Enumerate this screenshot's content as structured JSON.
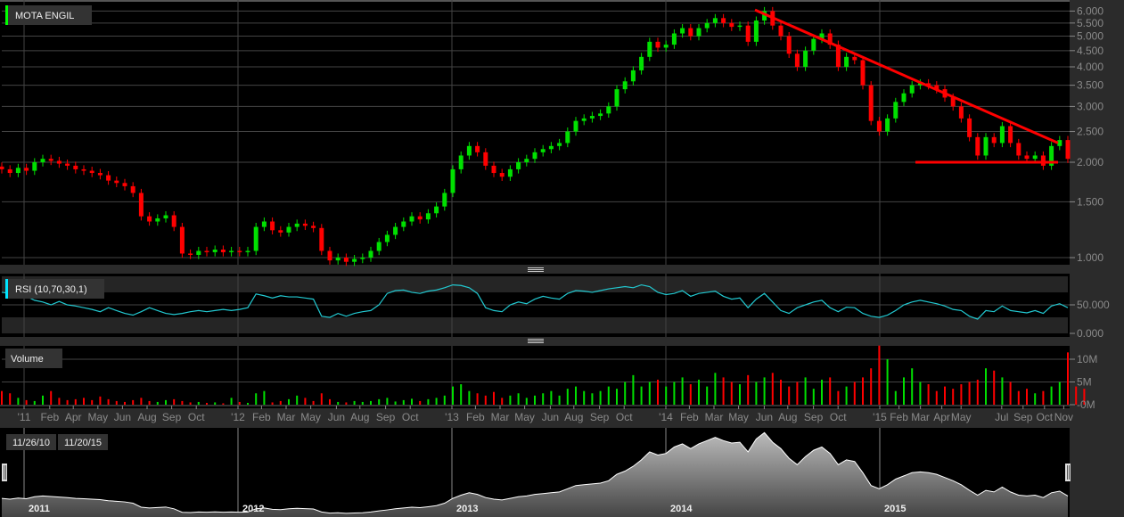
{
  "panels": {
    "price_title": "MOTA ENGIL",
    "rsi_title": "RSI (10,70,30,1)",
    "volume_title": "Volume"
  },
  "navigator": {
    "start_label": "11/26/10",
    "end_label": "11/20/15",
    "year_labels": [
      "2011",
      "2012",
      "2013",
      "2014",
      "2015"
    ]
  },
  "colors": {
    "up": "#00e000",
    "down": "#ff0000",
    "rsi": "#22c8d0",
    "trendline": "#ff0000",
    "title_marker_price": "#00ff00",
    "title_marker_rsi": "#00e5ff"
  },
  "chart_data": [
    {
      "type": "candlestick",
      "title": "MOTA ENGIL",
      "scale": "log",
      "yticks": [
        "1.000",
        "1.500",
        "2.000",
        "2.500",
        "3.000",
        "3.500",
        "4.000",
        "4.500",
        "5.000",
        "5.500",
        "6.000"
      ],
      "ytick_values": [
        1.0,
        1.5,
        2.0,
        2.5,
        3.0,
        3.5,
        4.0,
        4.5,
        5.0,
        5.5,
        6.0
      ],
      "date_range": [
        "11/26/10",
        "11/20/15"
      ],
      "close": [
        1.9,
        1.85,
        1.92,
        1.88,
        2.0,
        2.05,
        2.02,
        1.98,
        1.95,
        1.9,
        1.88,
        1.85,
        1.82,
        1.75,
        1.72,
        1.68,
        1.6,
        1.35,
        1.3,
        1.33,
        1.36,
        1.25,
        1.03,
        1.02,
        1.05,
        1.04,
        1.06,
        1.04,
        1.05,
        1.04,
        1.05,
        1.25,
        1.3,
        1.22,
        1.2,
        1.25,
        1.28,
        1.26,
        1.24,
        1.05,
        0.98,
        1.0,
        0.97,
        0.99,
        1.0,
        1.05,
        1.12,
        1.18,
        1.25,
        1.3,
        1.35,
        1.32,
        1.38,
        1.45,
        1.6,
        1.9,
        2.1,
        2.25,
        2.15,
        1.95,
        1.85,
        1.8,
        1.9,
        2.0,
        2.05,
        2.15,
        2.2,
        2.25,
        2.3,
        2.5,
        2.7,
        2.75,
        2.8,
        2.85,
        3.0,
        3.4,
        3.6,
        3.9,
        4.3,
        4.8,
        4.6,
        4.7,
        5.1,
        5.3,
        5.0,
        5.3,
        5.5,
        5.7,
        5.5,
        5.35,
        5.4,
        4.8,
        5.6,
        6.0,
        5.4,
        5.0,
        4.4,
        4.0,
        4.5,
        4.9,
        5.1,
        4.7,
        4.0,
        4.3,
        4.2,
        3.5,
        2.7,
        2.5,
        2.75,
        3.1,
        3.3,
        3.5,
        3.55,
        3.5,
        3.4,
        3.2,
        3.0,
        2.75,
        2.4,
        2.1,
        2.4,
        2.3,
        2.6,
        2.3,
        2.1,
        2.05,
        2.1,
        1.95,
        2.25,
        2.35,
        2.05
      ],
      "trendlines": [
        {
          "from": [
            "06/2014",
            6.05
          ],
          "to": [
            "11/2015",
            2.3
          ]
        },
        {
          "from": [
            "03/2015",
            2.0
          ],
          "to": [
            "11/2015",
            2.0
          ]
        }
      ]
    },
    {
      "type": "line",
      "title": "RSI (10,70,30,1)",
      "yticks": [
        "50.000",
        "0.000"
      ],
      "ytick_values": [
        50,
        0
      ],
      "bands": [
        70,
        30
      ],
      "values": [
        72,
        70,
        72,
        65,
        58,
        55,
        50,
        56,
        50,
        48,
        45,
        42,
        38,
        45,
        40,
        35,
        32,
        38,
        45,
        40,
        35,
        33,
        35,
        38,
        40,
        38,
        40,
        42,
        40,
        42,
        45,
        69,
        66,
        62,
        66,
        64,
        64,
        62,
        60,
        30,
        28,
        35,
        30,
        35,
        38,
        40,
        50,
        70,
        75,
        76,
        72,
        70,
        74,
        76,
        80,
        85,
        84,
        80,
        70,
        45,
        40,
        38,
        50,
        55,
        52,
        60,
        65,
        62,
        60,
        70,
        75,
        74,
        72,
        75,
        78,
        80,
        82,
        80,
        85,
        82,
        72,
        68,
        70,
        75,
        65,
        70,
        72,
        74,
        65,
        60,
        62,
        45,
        60,
        70,
        55,
        40,
        35,
        45,
        50,
        55,
        58,
        45,
        38,
        46,
        45,
        35,
        30,
        28,
        32,
        40,
        50,
        55,
        58,
        55,
        52,
        48,
        42,
        40,
        30,
        25,
        40,
        38,
        48,
        40,
        38,
        36,
        40,
        35,
        48,
        52,
        45
      ]
    },
    {
      "type": "bar",
      "title": "Volume",
      "yticks": [
        "10M",
        "5M",
        "-0M"
      ],
      "ytick_values": [
        10,
        5,
        0
      ],
      "unit": "M",
      "values": [
        3,
        2.5,
        1.5,
        1,
        0.8,
        2,
        3,
        1.5,
        1,
        1.2,
        1.5,
        1,
        1.8,
        1.2,
        0.8,
        0.6,
        1,
        1.5,
        0.8,
        0.6,
        1,
        1.2,
        0.8,
        0.5,
        0.6,
        0.4,
        0.5,
        0.3,
        1.5,
        0.6,
        0.4,
        2.5,
        3,
        0.5,
        0.8,
        1.2,
        2,
        1.5,
        0.8,
        2.5,
        1.2,
        0.6,
        0.5,
        0.8,
        0.6,
        0.8,
        1.2,
        1.5,
        0.7,
        1,
        1.3,
        0.8,
        1.2,
        1.5,
        2,
        4,
        4.5,
        3,
        2.5,
        2,
        2.8,
        1.5,
        2,
        2.5,
        1.5,
        2,
        2.5,
        3,
        2,
        3.5,
        4,
        3,
        2.5,
        3,
        4,
        3.5,
        5,
        6.5,
        4,
        5,
        5.5,
        4,
        5,
        6,
        4.5,
        5.5,
        4,
        7,
        6,
        5,
        4.5,
        6.5,
        5,
        6,
        7,
        5.5,
        4,
        5,
        6,
        3.5,
        5.5,
        6,
        3,
        4,
        5,
        6,
        8,
        13,
        10,
        3,
        6,
        8,
        5,
        4.5,
        3,
        4,
        3.5,
        4.5,
        5,
        5.5,
        8,
        7.5,
        6,
        5,
        3,
        3.5,
        2.5,
        3,
        4,
        5,
        11.5,
        4,
        3.5
      ]
    }
  ],
  "xaxis": {
    "ticks": [
      [
        "'11",
        2011.0
      ],
      [
        "Feb",
        2011.12
      ],
      [
        "Apr",
        2011.23
      ],
      [
        "May",
        2011.345
      ],
      [
        "Jun",
        2011.46
      ],
      [
        "Aug",
        2011.575
      ],
      [
        "Sep",
        2011.69
      ],
      [
        "Oct",
        2011.805
      ],
      [
        "'12",
        2012.0
      ],
      [
        "Feb",
        2012.11
      ],
      [
        "Mar",
        2012.225
      ],
      [
        "May",
        2012.34
      ],
      [
        "Jun",
        2012.46
      ],
      [
        "Aug",
        2012.57
      ],
      [
        "Sep",
        2012.69
      ],
      [
        "Oct",
        2012.805
      ],
      [
        "'13",
        2013.0
      ],
      [
        "Feb",
        2013.11
      ],
      [
        "Mar",
        2013.225
      ],
      [
        "May",
        2013.34
      ],
      [
        "Jun",
        2013.46
      ],
      [
        "Aug",
        2013.57
      ],
      [
        "Sep",
        2013.69
      ],
      [
        "Oct",
        2013.805
      ],
      [
        "'14",
        2014.0
      ],
      [
        "Feb",
        2014.11
      ],
      [
        "Mar",
        2014.225
      ],
      [
        "May",
        2014.34
      ],
      [
        "Jun",
        2014.46
      ],
      [
        "Aug",
        2014.57
      ],
      [
        "Sep",
        2014.69
      ],
      [
        "Oct",
        2014.805
      ],
      [
        "'15",
        2015.0
      ],
      [
        "Feb",
        2015.09
      ],
      [
        "Mar",
        2015.19
      ],
      [
        "Apr",
        2015.29
      ],
      [
        "May",
        2015.38
      ],
      [
        "Jul",
        2015.57
      ],
      [
        "Sep",
        2015.67
      ],
      [
        "Oct",
        2015.77
      ],
      [
        "Nov",
        2015.86
      ]
    ]
  }
}
